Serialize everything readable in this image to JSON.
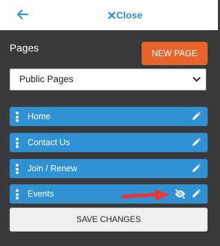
{
  "header": {
    "back_icon": "arrow-left-icon",
    "close_icon": "x-icon",
    "close_label": "Close",
    "accent_color": "#2d8fd6"
  },
  "pages_panel": {
    "title": "Pages",
    "new_page_label": "NEW PAGE",
    "filter_select": {
      "selected": "Public Pages"
    },
    "items": [
      {
        "label": "Home",
        "icons": [
          "drag-handle-icon",
          "pencil-icon"
        ]
      },
      {
        "label": "Contact Us",
        "icons": [
          "drag-handle-icon",
          "pencil-icon"
        ]
      },
      {
        "label": "Join / Renew",
        "icons": [
          "drag-handle-icon",
          "pencil-icon"
        ]
      },
      {
        "label": "Events",
        "icons": [
          "drag-handle-icon",
          "eye-slash-icon",
          "pencil-icon"
        ]
      }
    ],
    "save_label": "SAVE CHANGES"
  },
  "colors": {
    "panel_background": "#3a3a3c",
    "item_blue": "#3092d2",
    "new_page_orange": "#e8642d",
    "annotation_red": "#e8373a"
  }
}
